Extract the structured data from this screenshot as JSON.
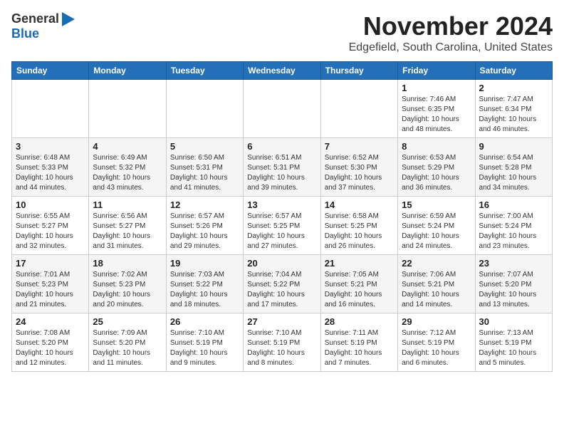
{
  "logo": {
    "general": "General",
    "blue": "Blue"
  },
  "title": "November 2024",
  "location": "Edgefield, South Carolina, United States",
  "days_header": [
    "Sunday",
    "Monday",
    "Tuesday",
    "Wednesday",
    "Thursday",
    "Friday",
    "Saturday"
  ],
  "weeks": [
    [
      {
        "day": "",
        "info": ""
      },
      {
        "day": "",
        "info": ""
      },
      {
        "day": "",
        "info": ""
      },
      {
        "day": "",
        "info": ""
      },
      {
        "day": "",
        "info": ""
      },
      {
        "day": "1",
        "info": "Sunrise: 7:46 AM\nSunset: 6:35 PM\nDaylight: 10 hours and 48 minutes."
      },
      {
        "day": "2",
        "info": "Sunrise: 7:47 AM\nSunset: 6:34 PM\nDaylight: 10 hours and 46 minutes."
      }
    ],
    [
      {
        "day": "3",
        "info": "Sunrise: 6:48 AM\nSunset: 5:33 PM\nDaylight: 10 hours and 44 minutes."
      },
      {
        "day": "4",
        "info": "Sunrise: 6:49 AM\nSunset: 5:32 PM\nDaylight: 10 hours and 43 minutes."
      },
      {
        "day": "5",
        "info": "Sunrise: 6:50 AM\nSunset: 5:31 PM\nDaylight: 10 hours and 41 minutes."
      },
      {
        "day": "6",
        "info": "Sunrise: 6:51 AM\nSunset: 5:31 PM\nDaylight: 10 hours and 39 minutes."
      },
      {
        "day": "7",
        "info": "Sunrise: 6:52 AM\nSunset: 5:30 PM\nDaylight: 10 hours and 37 minutes."
      },
      {
        "day": "8",
        "info": "Sunrise: 6:53 AM\nSunset: 5:29 PM\nDaylight: 10 hours and 36 minutes."
      },
      {
        "day": "9",
        "info": "Sunrise: 6:54 AM\nSunset: 5:28 PM\nDaylight: 10 hours and 34 minutes."
      }
    ],
    [
      {
        "day": "10",
        "info": "Sunrise: 6:55 AM\nSunset: 5:27 PM\nDaylight: 10 hours and 32 minutes."
      },
      {
        "day": "11",
        "info": "Sunrise: 6:56 AM\nSunset: 5:27 PM\nDaylight: 10 hours and 31 minutes."
      },
      {
        "day": "12",
        "info": "Sunrise: 6:57 AM\nSunset: 5:26 PM\nDaylight: 10 hours and 29 minutes."
      },
      {
        "day": "13",
        "info": "Sunrise: 6:57 AM\nSunset: 5:25 PM\nDaylight: 10 hours and 27 minutes."
      },
      {
        "day": "14",
        "info": "Sunrise: 6:58 AM\nSunset: 5:25 PM\nDaylight: 10 hours and 26 minutes."
      },
      {
        "day": "15",
        "info": "Sunrise: 6:59 AM\nSunset: 5:24 PM\nDaylight: 10 hours and 24 minutes."
      },
      {
        "day": "16",
        "info": "Sunrise: 7:00 AM\nSunset: 5:24 PM\nDaylight: 10 hours and 23 minutes."
      }
    ],
    [
      {
        "day": "17",
        "info": "Sunrise: 7:01 AM\nSunset: 5:23 PM\nDaylight: 10 hours and 21 minutes."
      },
      {
        "day": "18",
        "info": "Sunrise: 7:02 AM\nSunset: 5:23 PM\nDaylight: 10 hours and 20 minutes."
      },
      {
        "day": "19",
        "info": "Sunrise: 7:03 AM\nSunset: 5:22 PM\nDaylight: 10 hours and 18 minutes."
      },
      {
        "day": "20",
        "info": "Sunrise: 7:04 AM\nSunset: 5:22 PM\nDaylight: 10 hours and 17 minutes."
      },
      {
        "day": "21",
        "info": "Sunrise: 7:05 AM\nSunset: 5:21 PM\nDaylight: 10 hours and 16 minutes."
      },
      {
        "day": "22",
        "info": "Sunrise: 7:06 AM\nSunset: 5:21 PM\nDaylight: 10 hours and 14 minutes."
      },
      {
        "day": "23",
        "info": "Sunrise: 7:07 AM\nSunset: 5:20 PM\nDaylight: 10 hours and 13 minutes."
      }
    ],
    [
      {
        "day": "24",
        "info": "Sunrise: 7:08 AM\nSunset: 5:20 PM\nDaylight: 10 hours and 12 minutes."
      },
      {
        "day": "25",
        "info": "Sunrise: 7:09 AM\nSunset: 5:20 PM\nDaylight: 10 hours and 11 minutes."
      },
      {
        "day": "26",
        "info": "Sunrise: 7:10 AM\nSunset: 5:19 PM\nDaylight: 10 hours and 9 minutes."
      },
      {
        "day": "27",
        "info": "Sunrise: 7:10 AM\nSunset: 5:19 PM\nDaylight: 10 hours and 8 minutes."
      },
      {
        "day": "28",
        "info": "Sunrise: 7:11 AM\nSunset: 5:19 PM\nDaylight: 10 hours and 7 minutes."
      },
      {
        "day": "29",
        "info": "Sunrise: 7:12 AM\nSunset: 5:19 PM\nDaylight: 10 hours and 6 minutes."
      },
      {
        "day": "30",
        "info": "Sunrise: 7:13 AM\nSunset: 5:19 PM\nDaylight: 10 hours and 5 minutes."
      }
    ]
  ]
}
